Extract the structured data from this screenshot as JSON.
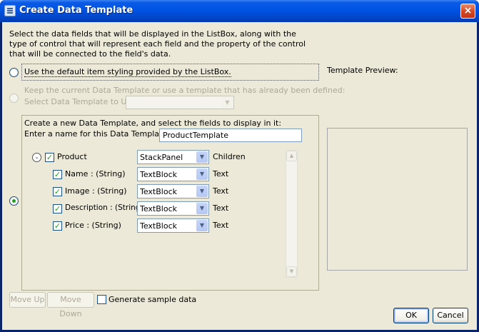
{
  "window": {
    "title": "Create Data Template",
    "icon": "dialog-icon",
    "close_icon": "×"
  },
  "instructions": "Select the data fields that will be displayed in the ListBox, along with the type of control that will represent each field and the property of the control that will be connected to the field's data.",
  "options": {
    "default_styling": "Use the default item styling provided by the ListBox.",
    "keep_current": "Keep the current Data Template or use a template that has already been defined:",
    "select_template_label": "Select Data Template to Use:",
    "select_template_value": "",
    "create_new": "Create a new Data Template, and select the fields to display in it:",
    "name_label": "Enter a name for this Data Template:",
    "name_value": "ProductTemplate",
    "selected_option": "create_new"
  },
  "tree": {
    "expander_icon": "⌄",
    "root": {
      "label": "Product",
      "checked": true,
      "control": "StackPanel",
      "property": "Children"
    },
    "fields": [
      {
        "label": "Name : (String)",
        "checked": true,
        "control": "TextBlock",
        "property": "Text"
      },
      {
        "label": "Image : (String)",
        "checked": true,
        "control": "TextBlock",
        "property": "Text"
      },
      {
        "label": "Description : (String)",
        "checked": true,
        "control": "TextBlock",
        "property": "Text"
      },
      {
        "label": "Price : (String)",
        "checked": true,
        "control": "TextBlock",
        "property": "Text"
      }
    ],
    "check_mark": "✓",
    "combo_arrow": "▼"
  },
  "preview": {
    "label": "Template Preview:"
  },
  "buttons": {
    "move_up": "Move Up",
    "move_down": "Move Down",
    "generate_sample": "Generate sample data",
    "generate_sample_checked": false,
    "ok": "OK",
    "cancel": "Cancel"
  },
  "scroll": {
    "up": "▲",
    "down": "▼"
  },
  "colors": {
    "titlebar": "#0054e3",
    "client": "#ece9d8",
    "check": "#21a121",
    "close": "#d4451e"
  }
}
